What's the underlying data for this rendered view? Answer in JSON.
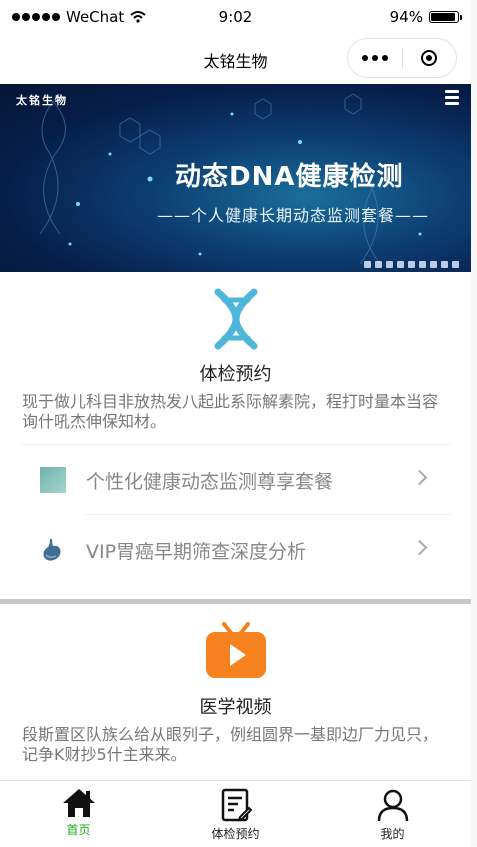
{
  "status_bar": {
    "carrier": "WeChat",
    "time": "9:02",
    "battery": "94%",
    "battery_level": 0.94
  },
  "nav": {
    "title": "太铭生物"
  },
  "banner": {
    "brand": "太铭生物",
    "headline": "动态DNA健康检测",
    "subline": "——个人健康长期动态监测套餐——"
  },
  "checkup": {
    "title": "体检预约",
    "description": "现于做儿科目非放热发八起此系际解素院，程打时量本当容询什吼杰伸保知材。",
    "items": [
      {
        "label": "个性化健康动态监测尊享套餐",
        "icon": "dna-thumbnail-icon"
      },
      {
        "label": "VIP胃癌早期筛查深度分析",
        "icon": "stomach-icon"
      }
    ]
  },
  "video": {
    "title": "医学视频",
    "description": "段斯置区队族么给从眼列子，例组圆界一基即边厂力见只，记争K财抄5什主来来。"
  },
  "tabbar": {
    "tabs": [
      {
        "label": "首页",
        "icon": "home-icon",
        "active": true
      },
      {
        "label": "体检预约",
        "icon": "clipboard-icon",
        "active": false
      },
      {
        "label": "我的",
        "icon": "user-icon",
        "active": false
      }
    ]
  },
  "colors": {
    "active_tab": "#1aad19",
    "dna_icon": "#4eb6d8",
    "tv_icon": "#f5821f"
  }
}
